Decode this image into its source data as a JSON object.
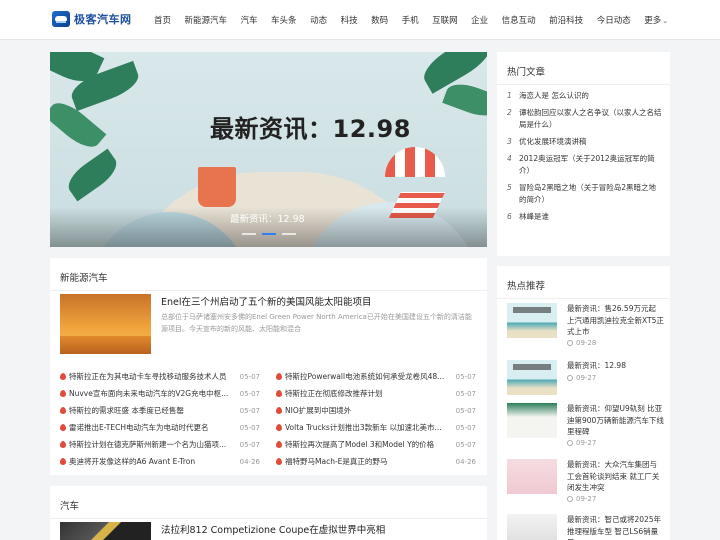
{
  "site": {
    "name": "极客汽车网"
  },
  "nav": [
    "首页",
    "新能源汽车",
    "汽车",
    "车头条",
    "动态",
    "科技",
    "数码",
    "手机",
    "互联网",
    "企业",
    "信息互动",
    "前沿科技",
    "今日动态",
    "更多"
  ],
  "banner": {
    "headline": "最新资讯：12.98",
    "caption": "最新资讯：12.98"
  },
  "new_energy": {
    "title": "新能源汽车",
    "feature": {
      "title": "Enel在三个州启动了五个新的美国风能太阳能项目",
      "desc": "总部位于马萨诸塞州安多佛的Enel Green Power North America已开始在美国建设五个新的清洁能源项目。今天宣布的新的风能、太阳能和混合"
    },
    "left_items": [
      {
        "text": "特斯拉正在为其电动卡车寻找移动服务技术人员",
        "date": "05-07"
      },
      {
        "text": "Nuvve宣布面向未来电动汽车的V2G充电中枢...",
        "date": "05-07"
      },
      {
        "text": "特斯拉的需求旺盛 本季度已经售罄",
        "date": "05-07"
      },
      {
        "text": "雷诺推出E-TECH电动汽车为电动时代更名",
        "date": "05-07"
      },
      {
        "text": "特斯拉计划在德克萨斯州新建一个名为山猫项...",
        "date": "05-07"
      },
      {
        "text": "奥迪将开发像这样的A6 Avant E-Tron",
        "date": "04-26"
      }
    ],
    "right_items": [
      {
        "text": "特斯拉Powerwall电池系统如何承受龙卷风48...",
        "date": "05-07"
      },
      {
        "text": "特斯拉正在彻底修改推荐计划",
        "date": "05-07"
      },
      {
        "text": "NIO扩展到中国境外",
        "date": "05-07"
      },
      {
        "text": "Volta Trucks计划推出3款新车 以加速北美市...",
        "date": "05-07"
      },
      {
        "text": "特斯拉再次提高了Model 3和Model Y的价格",
        "date": "05-07"
      },
      {
        "text": "福特野马Mach-E是真正的野马",
        "date": "04-26"
      }
    ]
  },
  "cars": {
    "title": "汽车",
    "feature_title": "法拉利812 Competizione Coupe在虚拟世界中亮相"
  },
  "hot_articles": {
    "title": "热门文章",
    "items": [
      {
        "num": "1",
        "text": "海恋人是 怎么认识的"
      },
      {
        "num": "2",
        "text": "谭松韵回应以家人之名争议（以家人之名结局是什么）"
      },
      {
        "num": "3",
        "text": "优化发展环境演讲稿"
      },
      {
        "num": "4",
        "text": "2012奥运冠军（关于2012奥运冠军的简介）"
      },
      {
        "num": "5",
        "text": "冒险岛2黑暗之地（关于冒险岛2黑暗之地的简介）"
      },
      {
        "num": "6",
        "text": "林峰是谁"
      }
    ]
  },
  "recommend": {
    "title": "热点推荐",
    "items": [
      {
        "title": "最新资讯：售26.59万元起 上汽通用凯迪拉克全新XT5正式上市",
        "date": "09-28"
      },
      {
        "title": "最新资讯：12.98",
        "date": "09-27"
      },
      {
        "title": "最新资讯：仰望U9轨刻 比亚迪第900万辆新能源汽车下线 里程碑",
        "date": "09-27"
      },
      {
        "title": "最新资讯：大众汽车集团与工会首轮谈判结束 就工厂关闭发生冲突",
        "date": "09-27"
      },
      {
        "title": "最新资讯：智己或将2025年推理程版车型 智己LS6销量目",
        "date": ""
      }
    ]
  }
}
